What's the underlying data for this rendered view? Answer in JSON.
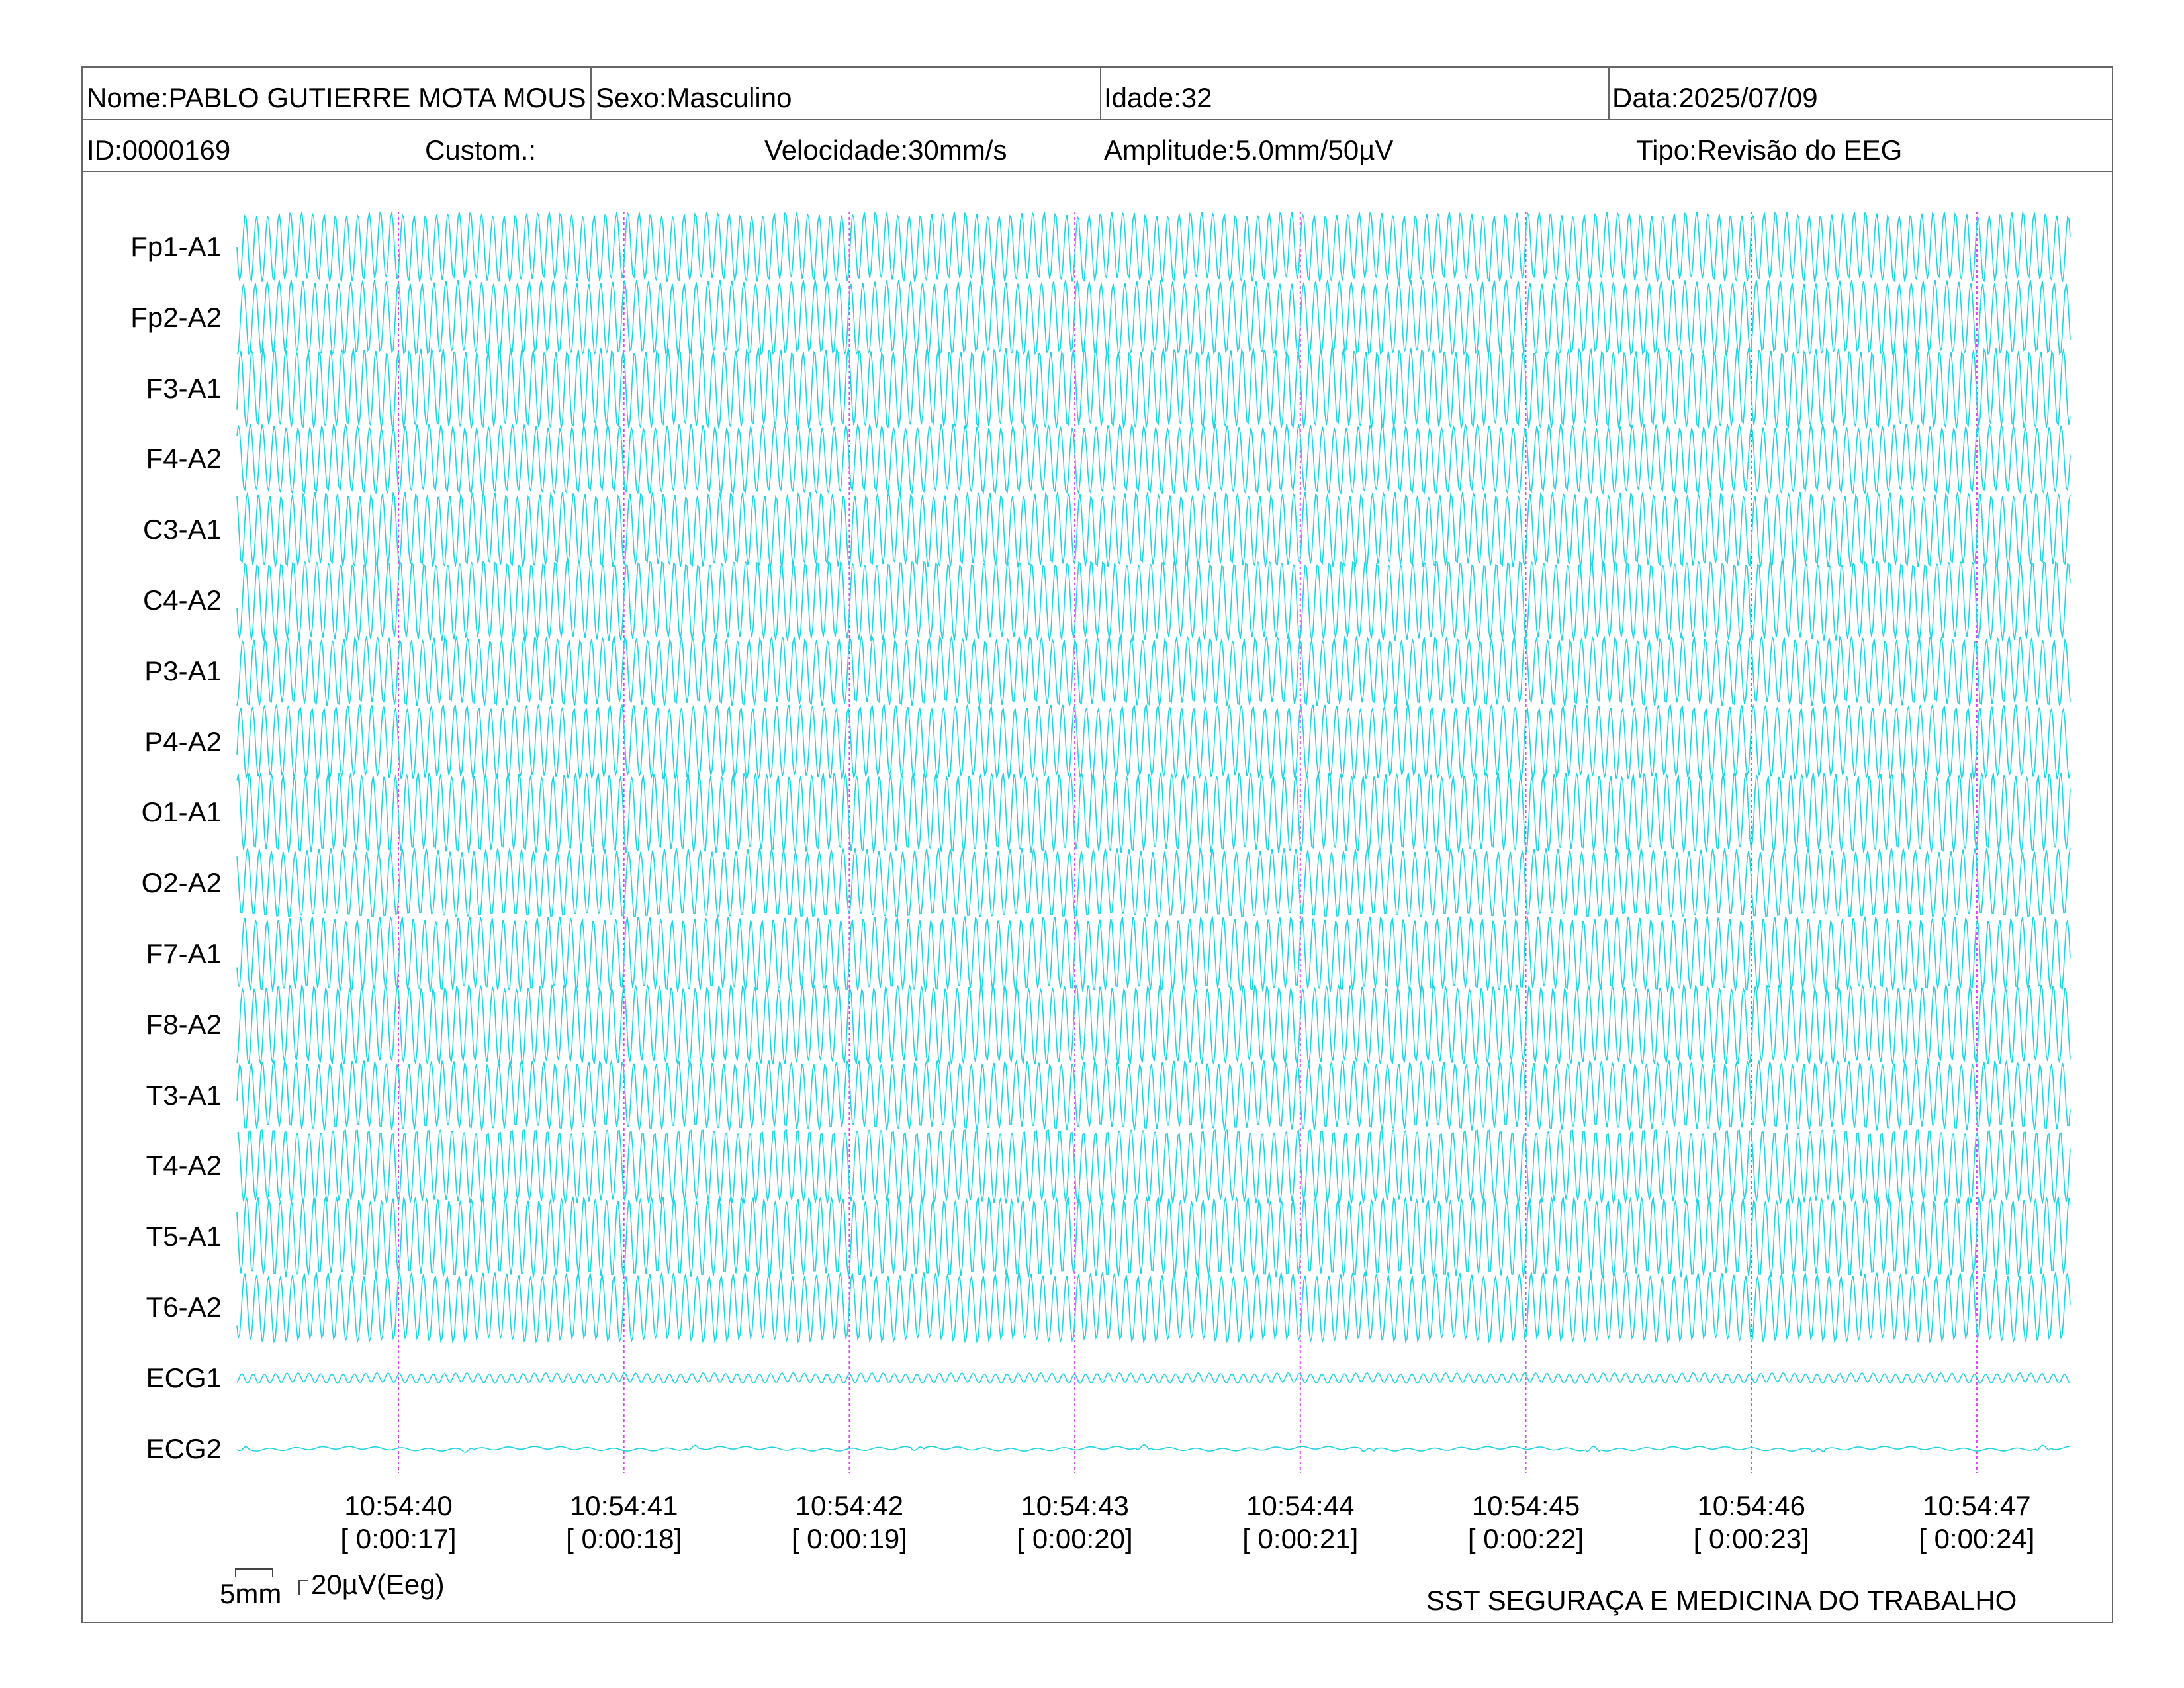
{
  "header": {
    "nome": "Nome:PABLO GUTIERRE MOTA MOUS",
    "sexo": "Sexo:Masculino",
    "idade": "Idade:32",
    "data": "Data:2025/07/09",
    "id": "ID:0000169",
    "custom": "Custom.:",
    "velocidade": "Velocidade:30mm/s",
    "amplitude": "Amplitude:5.0mm/50µV",
    "tipo": "Tipo:Revisão do EEG"
  },
  "footer": {
    "scale_time": "5mm",
    "scale_amp": "20µV(Eeg)",
    "company": "SST SEGURAÇA E MEDICINA DO TRABALHO"
  },
  "colors": {
    "trace": "#22d3e0",
    "marker": "#d946ef",
    "frame": "#666666"
  },
  "chart_data": {
    "type": "line",
    "channels": [
      "Fp1-A1",
      "Fp2-A2",
      "F3-A1",
      "F4-A2",
      "C3-A1",
      "C4-A2",
      "P3-A1",
      "P4-A2",
      "O1-A1",
      "O2-A2",
      "F7-A1",
      "F8-A2",
      "T3-A1",
      "T4-A2",
      "T5-A1",
      "T6-A2",
      "ECG1",
      "ECG2"
    ],
    "time_marks": [
      {
        "clock": "10:54:40",
        "elapsed": "[ 0:00:17]"
      },
      {
        "clock": "10:54:41",
        "elapsed": "[ 0:00:18]"
      },
      {
        "clock": "10:54:42",
        "elapsed": "[ 0:00:19]"
      },
      {
        "clock": "10:54:43",
        "elapsed": "[ 0:00:20]"
      },
      {
        "clock": "10:54:44",
        "elapsed": "[ 0:00:21]"
      },
      {
        "clock": "10:54:45",
        "elapsed": "[ 0:00:22]"
      },
      {
        "clock": "10:54:46",
        "elapsed": "[ 0:00:23]"
      },
      {
        "clock": "10:54:47",
        "elapsed": "[ 0:00:24]"
      }
    ],
    "speed_mm_per_s": 30,
    "sensitivity": "5.0mm/50µV",
    "grid": false
  }
}
